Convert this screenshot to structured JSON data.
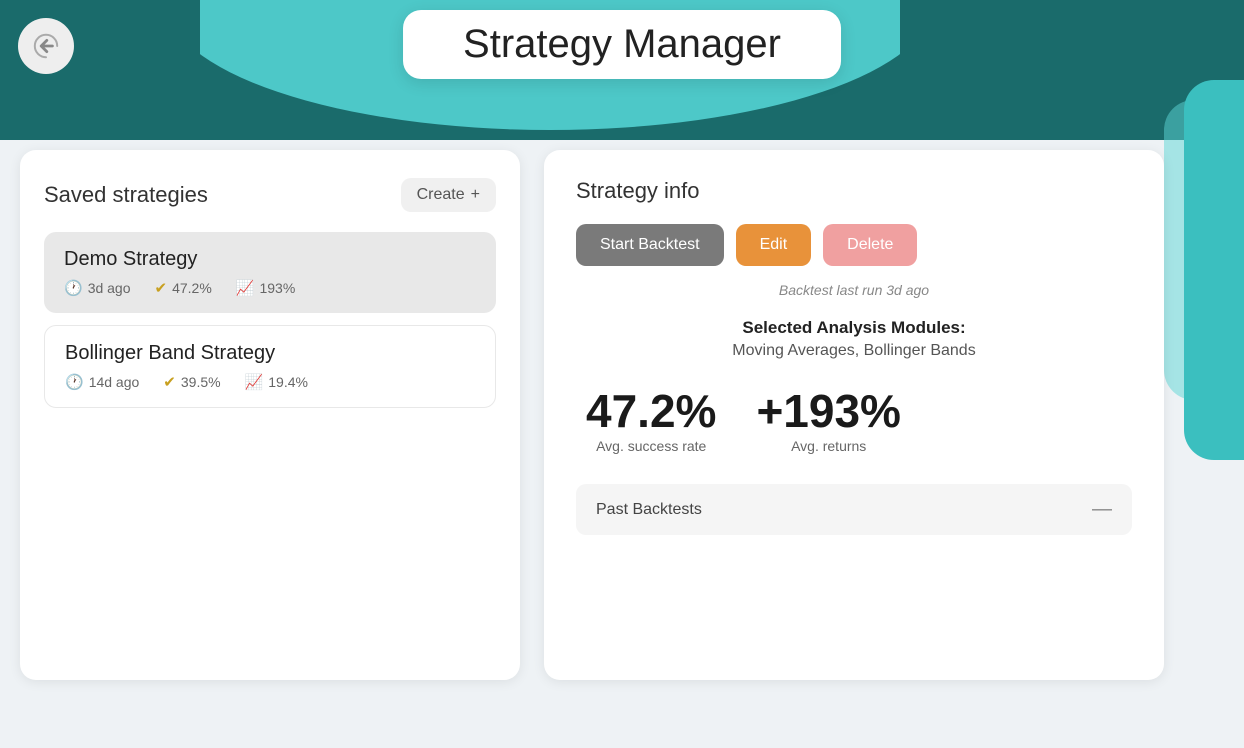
{
  "header": {
    "title": "Strategy Manager",
    "back_button_label": "Back"
  },
  "left_panel": {
    "title": "Saved strategies",
    "create_button": "Create",
    "create_icon": "+",
    "strategies": [
      {
        "name": "Demo Strategy",
        "age": "3d ago",
        "success_rate": "47.2%",
        "returns": "193%",
        "active": true
      },
      {
        "name": "Bollinger Band Strategy",
        "age": "14d ago",
        "success_rate": "39.5%",
        "returns": "19.4%",
        "active": false
      }
    ]
  },
  "right_panel": {
    "title": "Strategy info",
    "buttons": {
      "backtest": "Start Backtest",
      "edit": "Edit",
      "delete": "Delete"
    },
    "backtest_last_run": "Backtest last run 3d ago",
    "analysis_modules_label": "Selected Analysis Modules:",
    "analysis_modules_value": "Moving Averages, Bollinger Bands",
    "stats": [
      {
        "value": "47.2%",
        "label": "Avg. success rate"
      },
      {
        "value": "+193%",
        "label": "Avg. returns"
      }
    ],
    "past_backtests_label": "Past Backtests",
    "past_backtests_icon": "—"
  }
}
